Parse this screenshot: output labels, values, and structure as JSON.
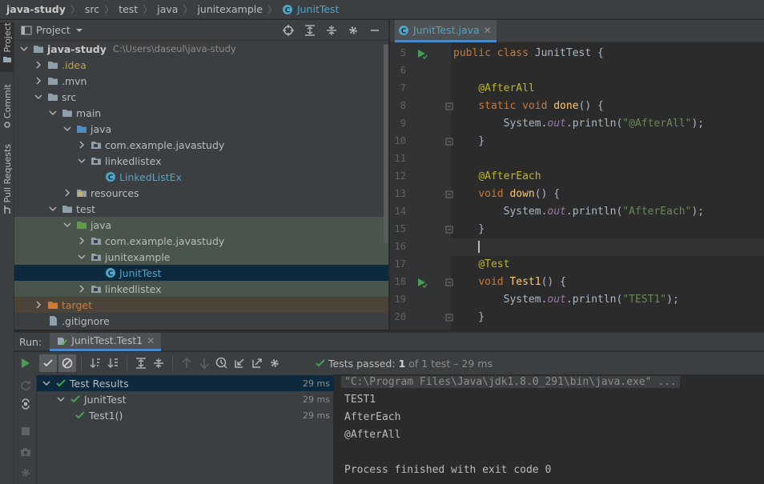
{
  "breadcrumb": [
    "java-study",
    "src",
    "test",
    "java",
    "junitexample",
    "JunitTest"
  ],
  "left_stripe": {
    "project": "Project",
    "commit": "Commit",
    "pull_requests": "Pull Requests"
  },
  "project_panel": {
    "title": "Project",
    "tree": [
      {
        "label": "java-study",
        "path": "C:\\Users\\daseul\\java-study",
        "depth": 0,
        "expanded": true,
        "icon": "folder-icon",
        "bold": true
      },
      {
        "label": ".idea",
        "depth": 1,
        "expanded": false,
        "icon": "folder-icon",
        "color": "#b8a354"
      },
      {
        "label": ".mvn",
        "depth": 1,
        "expanded": false,
        "icon": "folder-icon"
      },
      {
        "label": "src",
        "depth": 1,
        "expanded": true,
        "icon": "folder-icon"
      },
      {
        "label": "main",
        "depth": 2,
        "expanded": true,
        "icon": "folder-icon"
      },
      {
        "label": "java",
        "depth": 3,
        "expanded": true,
        "icon": "source-folder-icon"
      },
      {
        "label": "com.example.javastudy",
        "depth": 4,
        "expanded": false,
        "icon": "package-icon"
      },
      {
        "label": "linkedlistex",
        "depth": 4,
        "expanded": true,
        "icon": "package-icon"
      },
      {
        "label": "LinkedListEx",
        "depth": 5,
        "leaf": true,
        "icon": "class-icon",
        "color": "#4ea4c9"
      },
      {
        "label": "resources",
        "depth": 3,
        "expanded": false,
        "icon": "resources-folder-icon"
      },
      {
        "label": "test",
        "depth": 2,
        "expanded": true,
        "icon": "folder-icon"
      },
      {
        "label": "java",
        "depth": 3,
        "expanded": true,
        "icon": "test-folder-icon",
        "band": "test"
      },
      {
        "label": "com.example.javastudy",
        "depth": 4,
        "expanded": false,
        "icon": "package-icon",
        "band": "test"
      },
      {
        "label": "junitexample",
        "depth": 4,
        "expanded": true,
        "icon": "package-icon",
        "band": "test"
      },
      {
        "label": "JunitTest",
        "depth": 5,
        "leaf": true,
        "icon": "class-icon",
        "color": "#4ea4c9",
        "selected": true
      },
      {
        "label": "linkedlistex",
        "depth": 4,
        "expanded": false,
        "icon": "package-icon",
        "band": "test"
      },
      {
        "label": "target",
        "depth": 1,
        "expanded": false,
        "icon": "excluded-folder-icon",
        "color": "#d07b35",
        "band": "target"
      },
      {
        "label": ".gitignore",
        "depth": 1,
        "leaf": true,
        "icon": "file-icon"
      }
    ]
  },
  "editor": {
    "tab_label": "JunitTest.java",
    "lines": [
      {
        "n": "5",
        "run": true,
        "tokens": [
          [
            "kw",
            "public class "
          ],
          [
            "t",
            "JunitTest {"
          ]
        ]
      },
      {
        "n": "6",
        "tokens": []
      },
      {
        "n": "7",
        "tokens": [
          [
            "t",
            "    "
          ],
          [
            "ann",
            "@AfterAll"
          ]
        ]
      },
      {
        "n": "8",
        "fold": true,
        "tokens": [
          [
            "t",
            "    "
          ],
          [
            "kw",
            "static void "
          ],
          [
            "fn",
            "done"
          ],
          [
            "t",
            "() {"
          ]
        ]
      },
      {
        "n": "9",
        "tokens": [
          [
            "t",
            "        System."
          ],
          [
            "fld",
            "out"
          ],
          [
            "t",
            ".println("
          ],
          [
            "str",
            "\"@AfterAll\""
          ],
          [
            "t",
            ");"
          ]
        ]
      },
      {
        "n": "10",
        "fold": true,
        "tokens": [
          [
            "t",
            "    }"
          ]
        ]
      },
      {
        "n": "11",
        "tokens": []
      },
      {
        "n": "12",
        "tokens": [
          [
            "t",
            "    "
          ],
          [
            "ann",
            "@AfterEach"
          ]
        ]
      },
      {
        "n": "13",
        "fold": true,
        "tokens": [
          [
            "t",
            "    "
          ],
          [
            "kw",
            "void "
          ],
          [
            "fn",
            "down"
          ],
          [
            "t",
            "() {"
          ]
        ]
      },
      {
        "n": "14",
        "tokens": [
          [
            "t",
            "        System."
          ],
          [
            "fld",
            "out"
          ],
          [
            "t",
            ".println("
          ],
          [
            "str",
            "\"AfterEach\""
          ],
          [
            "t",
            ");"
          ]
        ]
      },
      {
        "n": "15",
        "fold": true,
        "tokens": [
          [
            "t",
            "    }"
          ]
        ]
      },
      {
        "n": "16",
        "current": true,
        "tokens": [
          [
            "t",
            "    "
          ]
        ]
      },
      {
        "n": "17",
        "tokens": [
          [
            "t",
            "    "
          ],
          [
            "ann",
            "@Test"
          ]
        ]
      },
      {
        "n": "18",
        "run": true,
        "fold": true,
        "tokens": [
          [
            "t",
            "    "
          ],
          [
            "kw",
            "void "
          ],
          [
            "fn",
            "Test1"
          ],
          [
            "t",
            "() {"
          ]
        ]
      },
      {
        "n": "19",
        "tokens": [
          [
            "t",
            "        System."
          ],
          [
            "fld",
            "out"
          ],
          [
            "t",
            ".println("
          ],
          [
            "str",
            "\"TEST1\""
          ],
          [
            "t",
            ");"
          ]
        ]
      },
      {
        "n": "20",
        "fold": true,
        "tokens": [
          [
            "t",
            "    }"
          ]
        ]
      }
    ]
  },
  "run": {
    "label": "Run:",
    "config_tab": "JunitTest.Test1",
    "status_prefix": "Tests passed:",
    "status_count": "1",
    "status_rest": "of 1 test – 29 ms"
  },
  "results": [
    {
      "label": "Test Results",
      "time": "29 ms",
      "depth": 0,
      "selected": true
    },
    {
      "label": "JunitTest",
      "time": "29 ms",
      "depth": 1
    },
    {
      "label": "Test1()",
      "time": "29 ms",
      "depth": 2
    }
  ],
  "console": [
    "\"C:\\Program Files\\Java\\jdk1.8.0_291\\bin\\java.exe\" ...",
    "TEST1",
    "AfterEach",
    "@AfterAll",
    "",
    "Process finished with exit code 0"
  ],
  "colors": {
    "accent": "#4ea4c9",
    "pass": "#499c54",
    "test_band": "#49544a",
    "target_band": "#4d4439",
    "selection": "#0d293e"
  }
}
